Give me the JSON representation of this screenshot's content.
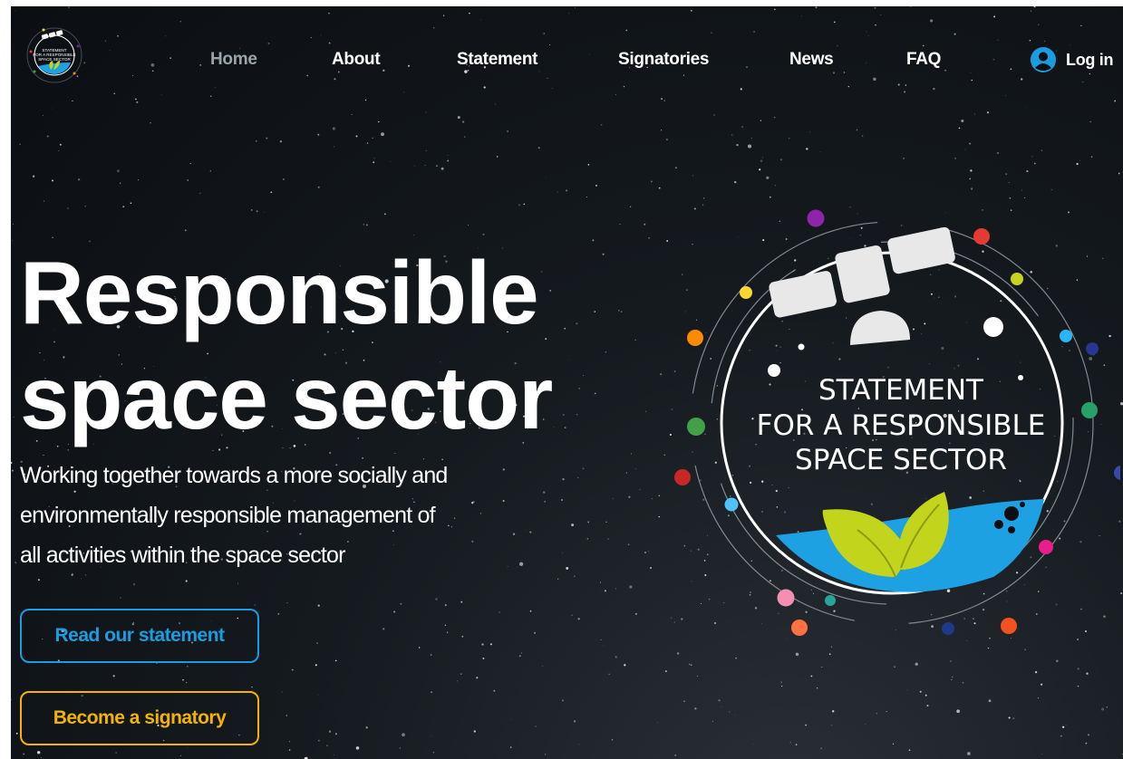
{
  "nav": {
    "logo_lines": [
      "STATEMENT",
      "FOR A RESPONSIBLE",
      "SPACE SECTOR"
    ],
    "items": [
      {
        "label": "Home",
        "active": true
      },
      {
        "label": "About"
      },
      {
        "label": "Statement"
      },
      {
        "label": "Signatories"
      },
      {
        "label": "News"
      },
      {
        "label": "FAQ"
      }
    ],
    "login_label": "Log in"
  },
  "hero": {
    "title_line1": "Responsible",
    "title_line2": "space sector",
    "subtitle_line1": "Working together towards a more socially and",
    "subtitle_line2": "environmentally responsible management of",
    "subtitle_line3": "all activities within the space sector",
    "read_button": "Read our statement",
    "sign_button": "Become a signatory"
  },
  "emblem": {
    "line1": "STATEMENT",
    "line2": "FOR A RESPONSIBLE",
    "line3": "SPACE SECTOR"
  },
  "colors": {
    "accent_blue": "#1a9de0",
    "accent_yellow": "#f2b400",
    "leaf_green": "#c3d41c",
    "wave_blue": "#1da1e2",
    "background": "#11161b"
  }
}
